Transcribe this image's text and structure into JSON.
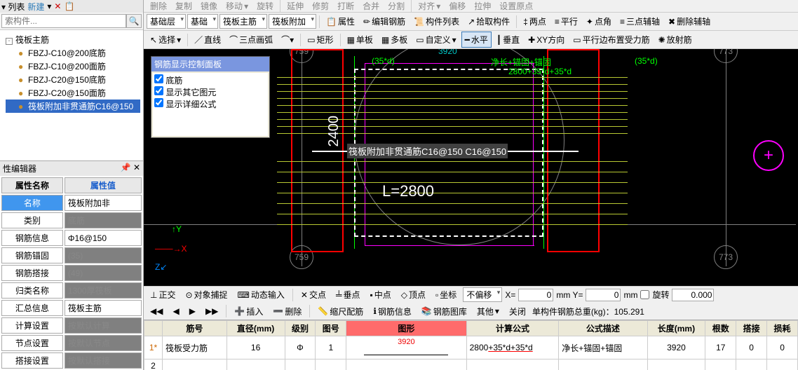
{
  "top_left": {
    "new_label": "新建",
    "search_placeholder": "索构件..."
  },
  "tree": {
    "root": "筏板主筋",
    "items": [
      "FBZJ-C10@200底筋",
      "FBZJ-C10@200面筋",
      "FBZJ-C20@150底筋",
      "FBZJ-C20@150面筋",
      "筏板附加非贯通筋C16@150"
    ]
  },
  "prop_panel": {
    "title": "性编辑器",
    "name_col": "属性名称",
    "value_col": "属性值",
    "rows": [
      {
        "name": "名称",
        "value": "筏板附加非",
        "blue": true
      },
      {
        "name": "类别",
        "value": "底筋",
        "gray": true
      },
      {
        "name": "钢筋信息",
        "value": "Φ16@150"
      },
      {
        "name": "钢筋锚固",
        "value": "(35)",
        "gray": true
      },
      {
        "name": "钢筋搭接",
        "value": "(49)",
        "gray": true
      },
      {
        "name": "归类名称",
        "value": "1300厚筏板",
        "gray": true
      },
      {
        "name": "汇总信息",
        "value": "筏板主筋"
      },
      {
        "name": "计算设置",
        "value": "按默认计算",
        "gray": true
      },
      {
        "name": "节点设置",
        "value": "按默认节点",
        "gray": true
      },
      {
        "name": "搭接设置",
        "value": "按默认搭接",
        "gray": true
      }
    ]
  },
  "toolbars": {
    "row1": [
      "删除",
      "复制",
      "镜像",
      "移动",
      "旋转",
      "延伸",
      "修剪",
      "打断",
      "合并",
      "分割",
      "对齐",
      "偏移",
      "拉伸",
      "设置原点"
    ],
    "row2a": [
      "基础层",
      "基础",
      "筏板主筋",
      "筏板附加"
    ],
    "row2b": [
      "属性",
      "编辑钢筋",
      "构件列表",
      "拾取构件"
    ],
    "row2c": [
      "两点",
      "平行",
      "点角",
      "三点辅轴",
      "删除辅轴"
    ],
    "row3a": [
      "选择",
      "直线",
      "三点画弧"
    ],
    "row3b": [
      "矩形",
      "单板",
      "多板",
      "自定义",
      "水平",
      "垂直",
      "XY方向",
      "平行边布置受力筋",
      "放射筋"
    ]
  },
  "floating": {
    "title": "钢筋显示控制面板",
    "items": [
      "底筋",
      "显示其它图元",
      "显示详细公式"
    ]
  },
  "canvas": {
    "dim_top": "3920",
    "label_left": "(35*d)",
    "label_right": "(35*d)",
    "label_formula": "2800+35*d+35*d",
    "label_net": "净长+锚固+锚固",
    "overlay_text": "筏板附加非贯通筋C16@150 C16@150",
    "length_text": "L=2800",
    "dim_side": "2400",
    "axis_left": "759",
    "axis_right": "773"
  },
  "status1": {
    "items": [
      "正交",
      "对象捕捉",
      "动态输入"
    ],
    "snap_items": [
      "交点",
      "垂点",
      "中点",
      "顶点",
      "坐标"
    ],
    "offset_label": "不偏移",
    "x_label": "X=",
    "x_val": "0",
    "y_label": "mm Y=",
    "y_val": "0",
    "mm": "mm",
    "rotate": "旋转",
    "rotate_val": "0.000"
  },
  "status2": {
    "nav": [
      "◀◀",
      "◀",
      "▶",
      "▶▶"
    ],
    "items": [
      "插入",
      "删除",
      "缩尺配筋",
      "钢筋信息",
      "钢筋图库",
      "其他",
      "关闭"
    ],
    "weight_label": "单构件钢筋总重(kg)：",
    "weight_val": "105.291"
  },
  "rebar_grid": {
    "cols": [
      "筋号",
      "直径(mm)",
      "级别",
      "图号",
      "图形",
      "计算公式",
      "公式描述",
      "长度(mm)",
      "根数",
      "搭接",
      "损耗"
    ],
    "rows": [
      {
        "idx": "1*",
        "name": "筏板受力筋",
        "dia": "16",
        "grade": "Φ",
        "fig": "1",
        "shape": "3920",
        "formula": "2800+35*d+35*d",
        "desc": "净长+锚固+锚固",
        "len": "3920",
        "count": "17",
        "lap": "0",
        "loss": "0"
      },
      {
        "idx": "2",
        "name": "",
        "dia": "",
        "grade": "",
        "fig": "",
        "shape": "",
        "formula": "",
        "desc": "",
        "len": "",
        "count": "",
        "lap": "",
        "loss": ""
      }
    ]
  }
}
